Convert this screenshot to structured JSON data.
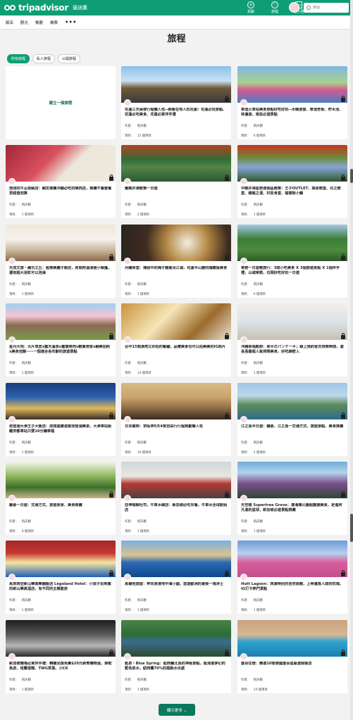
{
  "header": {
    "brand": "tripadvisor",
    "site_name": "貓途鷹",
    "actions": [
      {
        "label": "貢獻",
        "icon": "plus-icon"
      },
      {
        "label": "旅程",
        "icon": "heart-icon"
      },
      {
        "label": "收件匣",
        "icon": "message-icon"
      }
    ],
    "search_placeholder": "搜尋"
  },
  "subnav": {
    "items": [
      "飯店",
      "觀光",
      "餐廳",
      "機票"
    ],
    "more": "•••"
  },
  "page_title": "旅程",
  "filters": {
    "active_index": 0,
    "items": [
      "所有旅程",
      "私人旅程",
      "公開旅程"
    ]
  },
  "create_trip": "建立一個旅程",
  "author_label": "作者：",
  "count_label": "項目：",
  "trips": [
    {
      "title": "花蓮三天兩夜行程懶人包--跟著在地人玩花蓮！花蓮必玩景點、花蓮必吃美食、花蓮必買伴手禮",
      "author": "飛天豬",
      "count": "15 個項目"
    },
    {
      "title": "車埕火車站美食景點好吃好玩--木桶便當、車埕老街、貯木池、林邊道，南投必遊景點",
      "author": "飛天豬",
      "count": "6 個項目"
    },
    {
      "title": "琉球的牛@恩納店：網友推薦沖繩必吃的燒肉店，推薦午餐套餐更超值划算",
      "author": "飛天豬",
      "count": "1 個項目"
    },
    {
      "title": "舊輕井澤散策一日遊",
      "author": "飛天豬",
      "count": "2 個項目"
    },
    {
      "title": "中輕井澤星野渡假區散策：王子OUTLET、高原教堂、石之教堂、蜻蜓之湯、村民食堂、榆樹街小鎮",
      "author": "飛天豬",
      "count": "1 個項目"
    },
    {
      "title": "天成文旅・繪日之丘：超推美麗子飯店，房間附溫湯極小帳篷，還有超大浴缸可以泡澡",
      "author": "飛天豬",
      "count": "1 個項目"
    },
    {
      "title": "月鐘食堂：傳說中的梅子雞重出江湖，花蓮半山腰的隱藏版美食",
      "author": "飛天豬",
      "count": "1 個項目"
    },
    {
      "title": "東勢一日遊輕旅行：3間小吃美食 X 3個旅遊景點 X 1個伴手禮，山城東勢，石岡好吃好玩一日遊",
      "author": "飛天豬",
      "count": "6 個項目"
    },
    {
      "title": "星丹大地：大片草皮x露天溫泉x露營烤肉x觀賞夜景x網美拍照x美食佳餚⋯⋯一個適合各年齡的旅遊景點",
      "author": "飛天豬",
      "count": "1 個項目"
    },
    {
      "title": "台中15間漂亮又好拍的餐廳，品嚐美食也可以拍美美的IG照片",
      "author": "飛天豬",
      "count": "14 個項目"
    },
    {
      "title": "沖繩幸福鬆餅：幸せのパンケーキ；線上預約省去排隊時間，濃長島最超人氣排隊美食，好吃綿密入",
      "author": "飛天豬",
      "count": "1 個項目"
    },
    {
      "title": "琵琶湖大津王子大飯店：房間座擁滋賀琵琶湖美景，大津車站距離京都車站只要10分鐘車程",
      "author": "飛天豬",
      "count": "1 個項目"
    },
    {
      "title": "日本關西：京阪神5天4夜自由行行程規劃懶人包",
      "author": "飛天豬",
      "count": "19 個項目"
    },
    {
      "title": "江之島半日遊：鎌倉、江之島一交通方式、旅遊景點、美食推薦",
      "author": "飛天豬",
      "count": "5 個項目"
    },
    {
      "title": "鎌倉一日遊：交通方式、旅遊景景、美食推薦",
      "author": "飛天豬",
      "count": "8 個項目"
    },
    {
      "title": "亞坤咖椰吐司，牛車水總店：新加坡必吃早餐，牛車水全球創始店",
      "author": "飛天豬",
      "count": "1 個項目"
    },
    {
      "title": "天空樹 Supertree Grove：濱海灣公園超震撼美景，走進阿凡達的星球，新加坡必遊景點推薦",
      "author": "飛天豬",
      "count": "1 個項目"
    },
    {
      "title": "馬來西亞新山樂高樂園飯店 Legoland Hotel：小孩子玩到瘋的新山樂高酒店，有不同的主題套房",
      "author": "飛天豬",
      "count": "1 個項目"
    },
    {
      "title": "馬爾他旅遊：奔向浪漫地中海小國，悠遊歐洲的最後一塊淨土",
      "author": "飛天豬",
      "count": "1 個項目"
    },
    {
      "title": "Hutt Lagoon：西澳特別的自然景觀，上帝遺落人間的玫瑰，IG打卡熱門景點",
      "author": "飛天豬",
      "count": "1 個項目"
    },
    {
      "title": "新加坡機場必買伴手禮：轉機兌換免費$20元新幣購物金，餅乾魚皮、班蘭蛋糕、TWG茶葉、小CK",
      "author": "飛天豬",
      "count": "1 個項目"
    },
    {
      "title": "藍泉・Blue Spring：紐西蘭北島的神秘景點，超清澈夢幻的藍色泉水，紐西蘭70%的瓶裝水出處",
      "author": "飛天豬",
      "count": "1 個項目"
    },
    {
      "title": "曼谷住宿：精選10間泰國曼谷星級渡假飯店",
      "author": "飛天豬",
      "count": "10 個項目"
    }
  ],
  "show_more": "顯示更多 ⌄"
}
